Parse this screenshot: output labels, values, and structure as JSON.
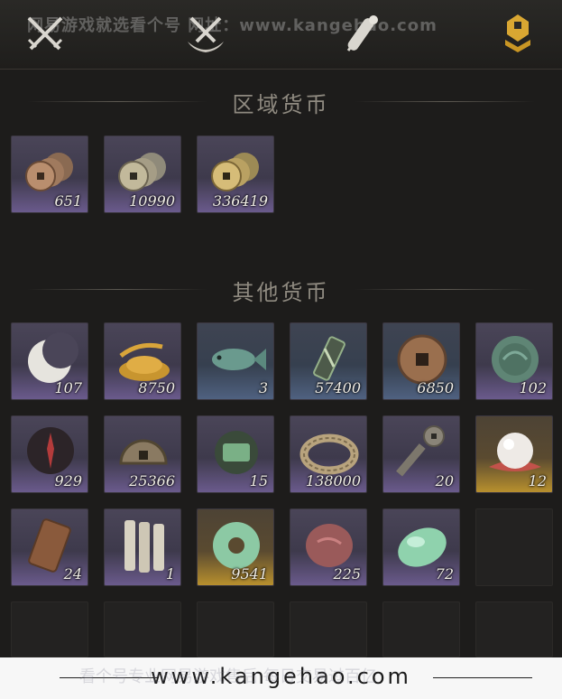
{
  "watermark_top": "网易游戏就选看个号   网址：www.kangehao.com",
  "tabs": [
    {
      "icon": "crossed-swords-icon"
    },
    {
      "icon": "bundle-icon"
    },
    {
      "icon": "scroll-icon"
    },
    {
      "icon": "coin-stack-icon",
      "active": true
    }
  ],
  "sections": {
    "regional": {
      "title": "区域货币"
    },
    "other": {
      "title": "其他货币"
    }
  },
  "regional_items": [
    {
      "icon": "copper-coins-icon",
      "count": "651",
      "rarity": "purple"
    },
    {
      "icon": "silver-coins-icon",
      "count": "10990",
      "rarity": "purple"
    },
    {
      "icon": "gold-coins-icon",
      "count": "336419",
      "rarity": "purple"
    }
  ],
  "other_items": [
    {
      "icon": "crescent-jade-icon",
      "count": "107",
      "rarity": "purple"
    },
    {
      "icon": "grain-pile-icon",
      "count": "8750",
      "rarity": "purple"
    },
    {
      "icon": "jade-fish-icon",
      "count": "3",
      "rarity": "blue"
    },
    {
      "icon": "token-plaque-icon",
      "count": "57400",
      "rarity": "blue"
    },
    {
      "icon": "bronze-coin-icon",
      "count": "6850",
      "rarity": "blue"
    },
    {
      "icon": "jade-disc-icon",
      "count": "102",
      "rarity": "purple"
    },
    {
      "icon": "dark-sigil-icon",
      "count": "929",
      "rarity": "purple"
    },
    {
      "icon": "half-coin-icon",
      "count": "25366",
      "rarity": "purple"
    },
    {
      "icon": "green-tablet-icon",
      "count": "15",
      "rarity": "purple"
    },
    {
      "icon": "coin-string-icon",
      "count": "138000",
      "rarity": "purple"
    },
    {
      "icon": "coin-sword-icon",
      "count": "20",
      "rarity": "purple"
    },
    {
      "icon": "pearl-icon",
      "count": "12",
      "rarity": "gold"
    },
    {
      "icon": "bronze-tag-icon",
      "count": "24",
      "rarity": "purple"
    },
    {
      "icon": "bamboo-slips-icon",
      "count": "1",
      "rarity": "purple"
    },
    {
      "icon": "jade-ring-icon",
      "count": "9541",
      "rarity": "gold"
    },
    {
      "icon": "red-stone-icon",
      "count": "225",
      "rarity": "purple"
    },
    {
      "icon": "green-jade-icon",
      "count": "72",
      "rarity": "purple"
    }
  ],
  "footer": {
    "url": "www.kangehao.com",
    "ghost_text": "看个号专业网易游戏售后 每日交易过百亿"
  }
}
